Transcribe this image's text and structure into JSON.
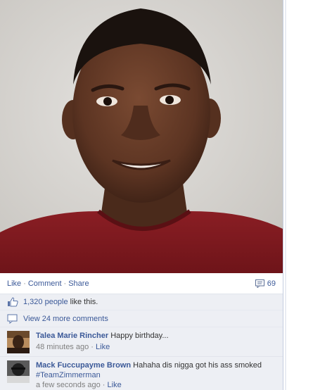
{
  "post": {
    "like_label": "Like",
    "comment_label": "Comment",
    "share_label": "Share",
    "separator": "·",
    "comment_count": "69"
  },
  "likes": {
    "count_link": "1,320 people",
    "suffix": "like this."
  },
  "view_more": {
    "label": "View 24 more comments"
  },
  "comments": [
    {
      "author": "Talea Marie Rincher",
      "text": "Happy birthday...",
      "time": "48 minutes ago",
      "like_label": "Like"
    },
    {
      "author": "Mack Fuccupayme Brown",
      "text": "Hahaha dis nigga got his ass smoked",
      "hashtag": "#TeamZimmerman",
      "time": "a few seconds ago",
      "like_label": "Like"
    }
  ],
  "colors": {
    "link": "#3b5998",
    "ufi_background": "#edeff4",
    "meta_text": "#808080"
  },
  "icons": {
    "comment_count": "speech-bubble-icon",
    "likes": "thumbs-up-icon",
    "view_more": "comment-bubble-icon"
  }
}
